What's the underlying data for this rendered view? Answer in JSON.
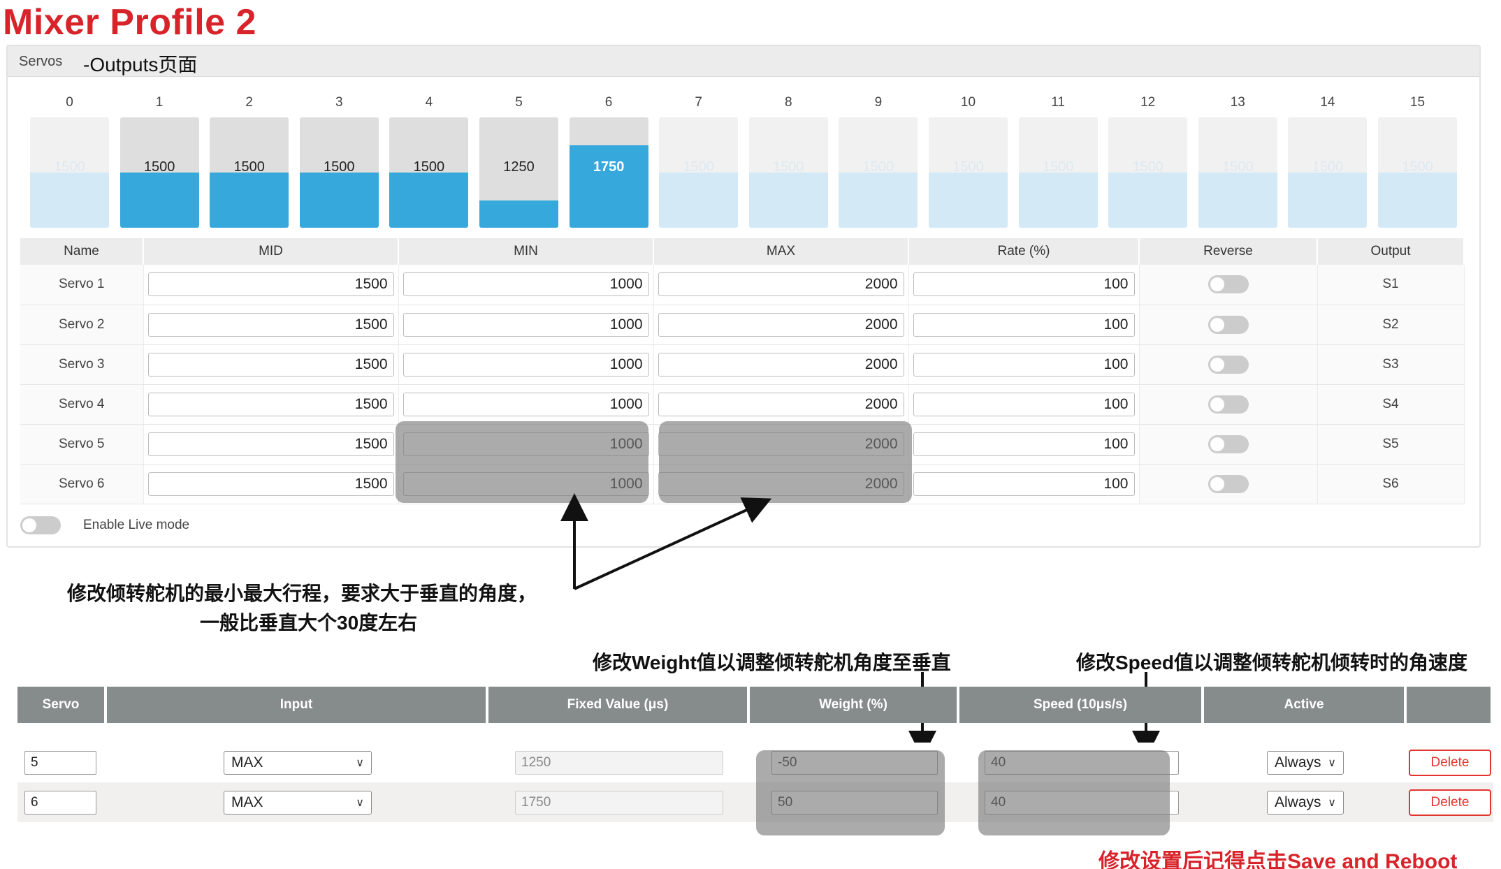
{
  "page_title": "Mixer Profile 2",
  "servos_panel": {
    "header_label": "Servos",
    "header_annotation": "-Outputs页面",
    "bars": [
      {
        "index": "0",
        "value": "1500",
        "fill": 0.5,
        "active": false
      },
      {
        "index": "1",
        "value": "1500",
        "fill": 0.5,
        "active": true
      },
      {
        "index": "2",
        "value": "1500",
        "fill": 0.5,
        "active": true
      },
      {
        "index": "3",
        "value": "1500",
        "fill": 0.5,
        "active": true
      },
      {
        "index": "4",
        "value": "1500",
        "fill": 0.5,
        "active": true
      },
      {
        "index": "5",
        "value": "1250",
        "fill": 0.25,
        "active": true
      },
      {
        "index": "6",
        "value": "1750",
        "fill": 0.75,
        "active": true
      },
      {
        "index": "7",
        "value": "1500",
        "fill": 0.5,
        "active": false
      },
      {
        "index": "8",
        "value": "1500",
        "fill": 0.5,
        "active": false
      },
      {
        "index": "9",
        "value": "1500",
        "fill": 0.5,
        "active": false
      },
      {
        "index": "10",
        "value": "1500",
        "fill": 0.5,
        "active": false
      },
      {
        "index": "11",
        "value": "1500",
        "fill": 0.5,
        "active": false
      },
      {
        "index": "12",
        "value": "1500",
        "fill": 0.5,
        "active": false
      },
      {
        "index": "13",
        "value": "1500",
        "fill": 0.5,
        "active": false
      },
      {
        "index": "14",
        "value": "1500",
        "fill": 0.5,
        "active": false
      },
      {
        "index": "15",
        "value": "1500",
        "fill": 0.5,
        "active": false
      }
    ],
    "table_headers": [
      "Name",
      "MID",
      "MIN",
      "MAX",
      "Rate (%)",
      "Reverse",
      "Output"
    ],
    "rows": [
      {
        "name": "Servo 1",
        "mid": "1500",
        "min": "1000",
        "max": "2000",
        "rate": "100",
        "output": "S1"
      },
      {
        "name": "Servo 2",
        "mid": "1500",
        "min": "1000",
        "max": "2000",
        "rate": "100",
        "output": "S2"
      },
      {
        "name": "Servo 3",
        "mid": "1500",
        "min": "1000",
        "max": "2000",
        "rate": "100",
        "output": "S3"
      },
      {
        "name": "Servo 4",
        "mid": "1500",
        "min": "1000",
        "max": "2000",
        "rate": "100",
        "output": "S4"
      },
      {
        "name": "Servo 5",
        "mid": "1500",
        "min": "1000",
        "max": "2000",
        "rate": "100",
        "output": "S5"
      },
      {
        "name": "Servo 6",
        "mid": "1500",
        "min": "1000",
        "max": "2000",
        "rate": "100",
        "output": "S6"
      }
    ],
    "live_mode_label": "Enable Live mode"
  },
  "annotations": {
    "minmax_line1": "修改倾转舵机的最小最大行程，要求大于垂直的角度，",
    "minmax_line2": "一般比垂直大个30度左右",
    "weight": "修改Weight值以调整倾转舵机角度至垂直",
    "speed": "修改Speed值以调整倾转舵机倾转时的角速度",
    "save": "修改设置后记得点击Save and Reboot"
  },
  "mixer_table": {
    "headers": [
      "Servo",
      "Input",
      "Fixed Value (μs)",
      "Weight (%)",
      "Speed (10μs/s)",
      "Active",
      ""
    ],
    "rows": [
      {
        "servo": "5",
        "input": "MAX",
        "fixed": "1250",
        "weight": "-50",
        "speed": "40",
        "active": "Always",
        "delete": "Delete"
      },
      {
        "servo": "6",
        "input": "MAX",
        "fixed": "1750",
        "weight": "50",
        "speed": "40",
        "active": "Always",
        "delete": "Delete"
      }
    ]
  },
  "colors": {
    "title_red": "#d8232a",
    "bar_active_fill": "#37a8db",
    "bar_inactive_fill": "#d3e9f6",
    "mixer_header": "#858c8b",
    "delete_red": "#e2352f"
  }
}
